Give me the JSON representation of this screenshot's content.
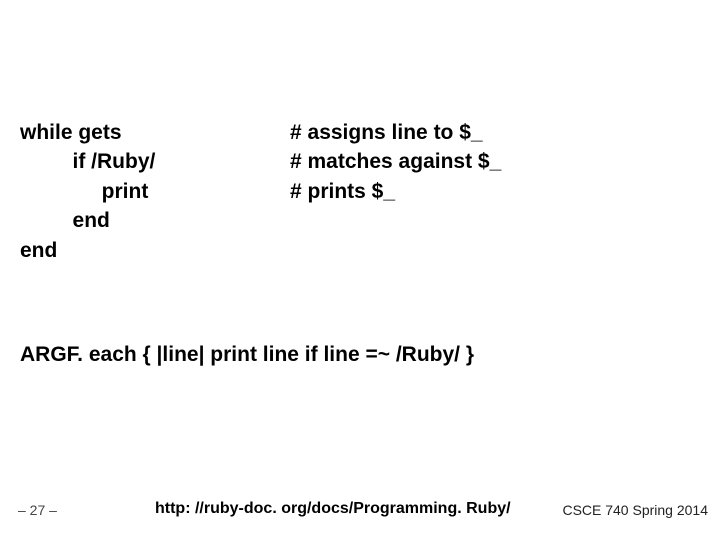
{
  "code": {
    "lines": [
      {
        "left": "while gets",
        "comment": "# assigns line to $_"
      },
      {
        "left": "         if /Ruby/",
        "comment": "# matches against $_"
      },
      {
        "left": "              print",
        "comment": "# prints $_"
      },
      {
        "left": "         end",
        "comment": ""
      },
      {
        "left": "end",
        "comment": ""
      }
    ],
    "argf": "ARGF. each { |line|  print line  if line =~ /Ruby/ }"
  },
  "footer": {
    "page": "– 27 –",
    "url": "http: //ruby-doc. org/docs/Programming. Ruby/",
    "course": "CSCE 740 Spring 2014"
  }
}
